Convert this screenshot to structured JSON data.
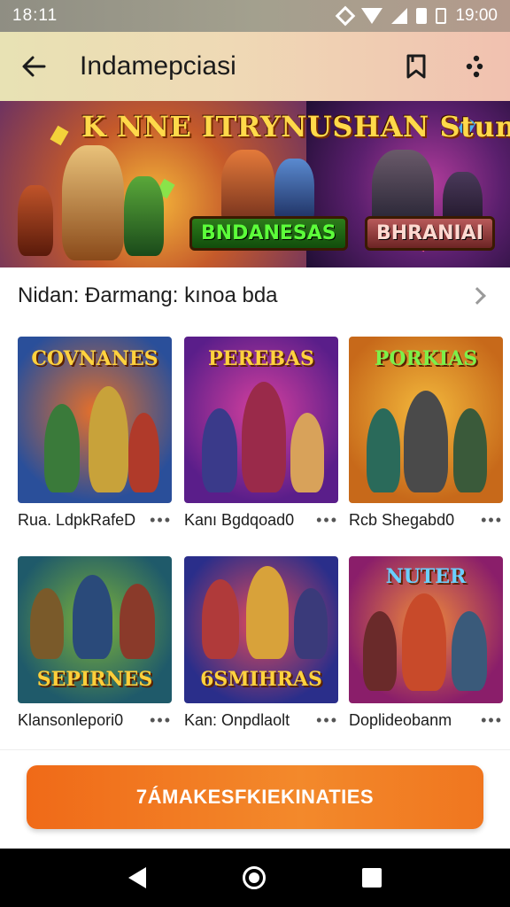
{
  "status_bar": {
    "left_text": "18:11",
    "time": "19:00",
    "icons": [
      "nfc-diamond-icon",
      "wifi-icon",
      "signal-icon",
      "battery-icon"
    ]
  },
  "app_bar": {
    "title": "Indamepciasi",
    "back_icon": "arrow-left-icon",
    "actions": [
      "bookmark-icon",
      "more-vert-icon"
    ]
  },
  "hero": {
    "title": "K NNE ITRYNUSHAN Stumuianor..",
    "badge_left": "BNDANESAS",
    "badge_right": "BHRANIAI"
  },
  "section": {
    "title": "Nidan: Ðarmang: kınoa bda",
    "chevron_icon": "chevron-right-icon"
  },
  "cards": [
    {
      "thumb_title": "COVNANES",
      "label": "Rua. LdpkRafeD",
      "bg": [
        "#2a4f9a",
        "#e6702a"
      ]
    },
    {
      "thumb_title": "PEREBAS",
      "label": "Kanı Bgdqoad0",
      "bg": [
        "#5a1e8a",
        "#d6409e"
      ]
    },
    {
      "thumb_title": "PORKIAS",
      "label": "Rcb Shegabd0",
      "bg": [
        "#c7691a",
        "#f3b93c"
      ]
    },
    {
      "thumb_title": "SEPIRNES",
      "label": "Klansonlepori0",
      "bg": [
        "#1f5a6a",
        "#7cb23a"
      ]
    },
    {
      "thumb_title": "6SMIHRAS",
      "label": "Kan: Onpdlaolt",
      "bg": [
        "#2a2e8a",
        "#e24a5a"
      ]
    },
    {
      "thumb_title": "NUTER",
      "label": "Doplideobanm",
      "bg": [
        "#8a1e6a",
        "#f08a3a"
      ]
    }
  ],
  "more_glyph": "•••",
  "cta": {
    "label": "7ÁMAKESFKIEKINATIES",
    "color": "#f07a22"
  },
  "nav_bar": {
    "icons": [
      "nav-back-icon",
      "nav-home-icon",
      "nav-recents-icon"
    ]
  }
}
